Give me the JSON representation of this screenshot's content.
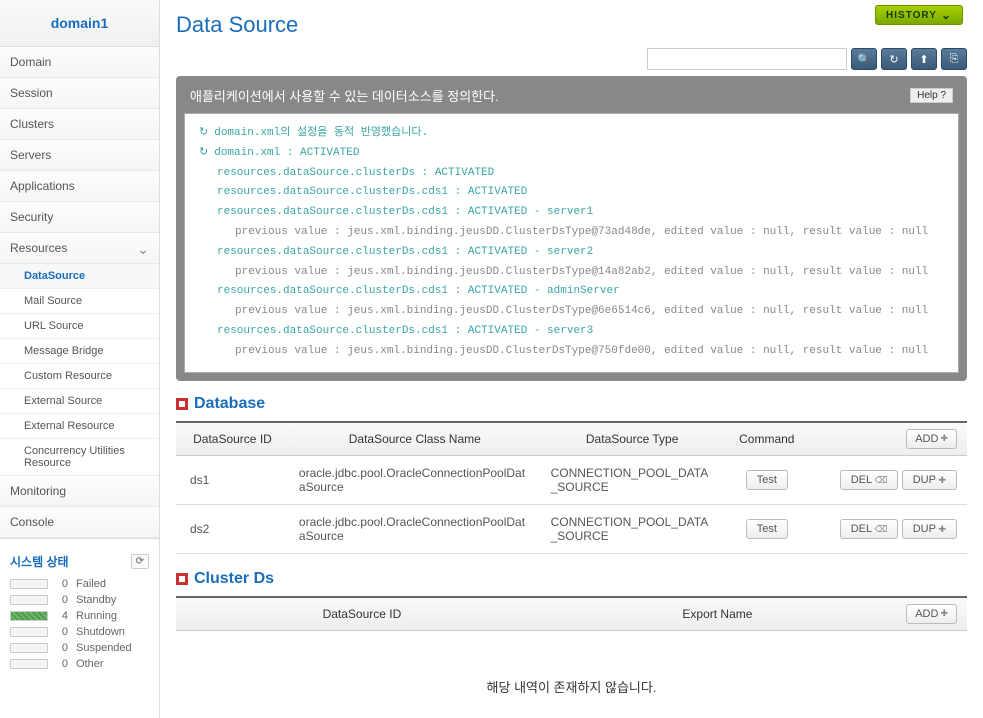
{
  "domain_name": "domain1",
  "nav": {
    "items": [
      "Domain",
      "Session",
      "Clusters",
      "Servers",
      "Applications",
      "Security",
      "Resources"
    ],
    "resources_sub": [
      "DataSource",
      "Mail Source",
      "URL Source",
      "Message Bridge",
      "Custom Resource",
      "External Source",
      "External Resource",
      "Concurrency Utilities Resource"
    ],
    "monitoring": "Monitoring",
    "console": "Console"
  },
  "status": {
    "title": "시스템 상태",
    "items": [
      {
        "count": "0",
        "label": "Failed"
      },
      {
        "count": "0",
        "label": "Standby"
      },
      {
        "count": "4",
        "label": "Running"
      },
      {
        "count": "0",
        "label": "Shutdown"
      },
      {
        "count": "0",
        "label": "Suspended"
      },
      {
        "count": "0",
        "label": "Other"
      }
    ]
  },
  "page": {
    "title": "Data Source",
    "history_label": "HISTORY"
  },
  "info": {
    "description": "애플리케이션에서 사용할 수 있는 데이터소스를 정의한다.",
    "help_label": "Help ?",
    "logs": [
      {
        "icon": true,
        "text": "domain.xml의 설정을 동적 반영했습니다.",
        "cls": "green"
      },
      {
        "icon": true,
        "text": "domain.xml : ACTIVATED",
        "cls": "green"
      },
      {
        "text": "resources.dataSource.clusterDs : ACTIVATED",
        "cls": "green indent1"
      },
      {
        "text": "resources.dataSource.clusterDs.cds1 : ACTIVATED",
        "cls": "green indent1"
      },
      {
        "text": "resources.dataSource.clusterDs.cds1 : ACTIVATED - server1",
        "cls": "green indent1"
      },
      {
        "text": "previous value : jeus.xml.binding.jeusDD.ClusterDsType@73ad48de, edited value : null, result value : null",
        "cls": "gray indent2"
      },
      {
        "text": "resources.dataSource.clusterDs.cds1 : ACTIVATED - server2",
        "cls": "green indent1"
      },
      {
        "text": "previous value : jeus.xml.binding.jeusDD.ClusterDsType@14a82ab2, edited value : null, result value : null",
        "cls": "gray indent2"
      },
      {
        "text": "resources.dataSource.clusterDs.cds1 : ACTIVATED - adminServer",
        "cls": "green indent1"
      },
      {
        "text": "previous value : jeus.xml.binding.jeusDD.ClusterDsType@6e6514c6, edited value : null, result value : null",
        "cls": "gray indent2"
      },
      {
        "text": "resources.dataSource.clusterDs.cds1 : ACTIVATED - server3",
        "cls": "green indent1"
      },
      {
        "text": "previous value : jeus.xml.binding.jeusDD.ClusterDsType@750fde00, edited value : null, result value : null",
        "cls": "gray indent2"
      }
    ]
  },
  "database": {
    "title": "Database",
    "headers": [
      "DataSource ID",
      "DataSource Class Name",
      "DataSource Type",
      "Command"
    ],
    "add_label": "ADD",
    "del_label": "DEL",
    "dup_label": "DUP",
    "test_label": "Test",
    "rows": [
      {
        "id": "ds1",
        "className": "oracle.jdbc.pool.OracleConnectionPoolDataSource",
        "type": "CONNECTION_POOL_DATA_SOURCE"
      },
      {
        "id": "ds2",
        "className": "oracle.jdbc.pool.OracleConnectionPoolDataSource",
        "type": "CONNECTION_POOL_DATA_SOURCE"
      }
    ]
  },
  "clusterds": {
    "title": "Cluster Ds",
    "headers": [
      "DataSource ID",
      "Export Name"
    ],
    "add_label": "ADD",
    "empty_msg": "해당 내역이 존재하지 않습니다."
  }
}
